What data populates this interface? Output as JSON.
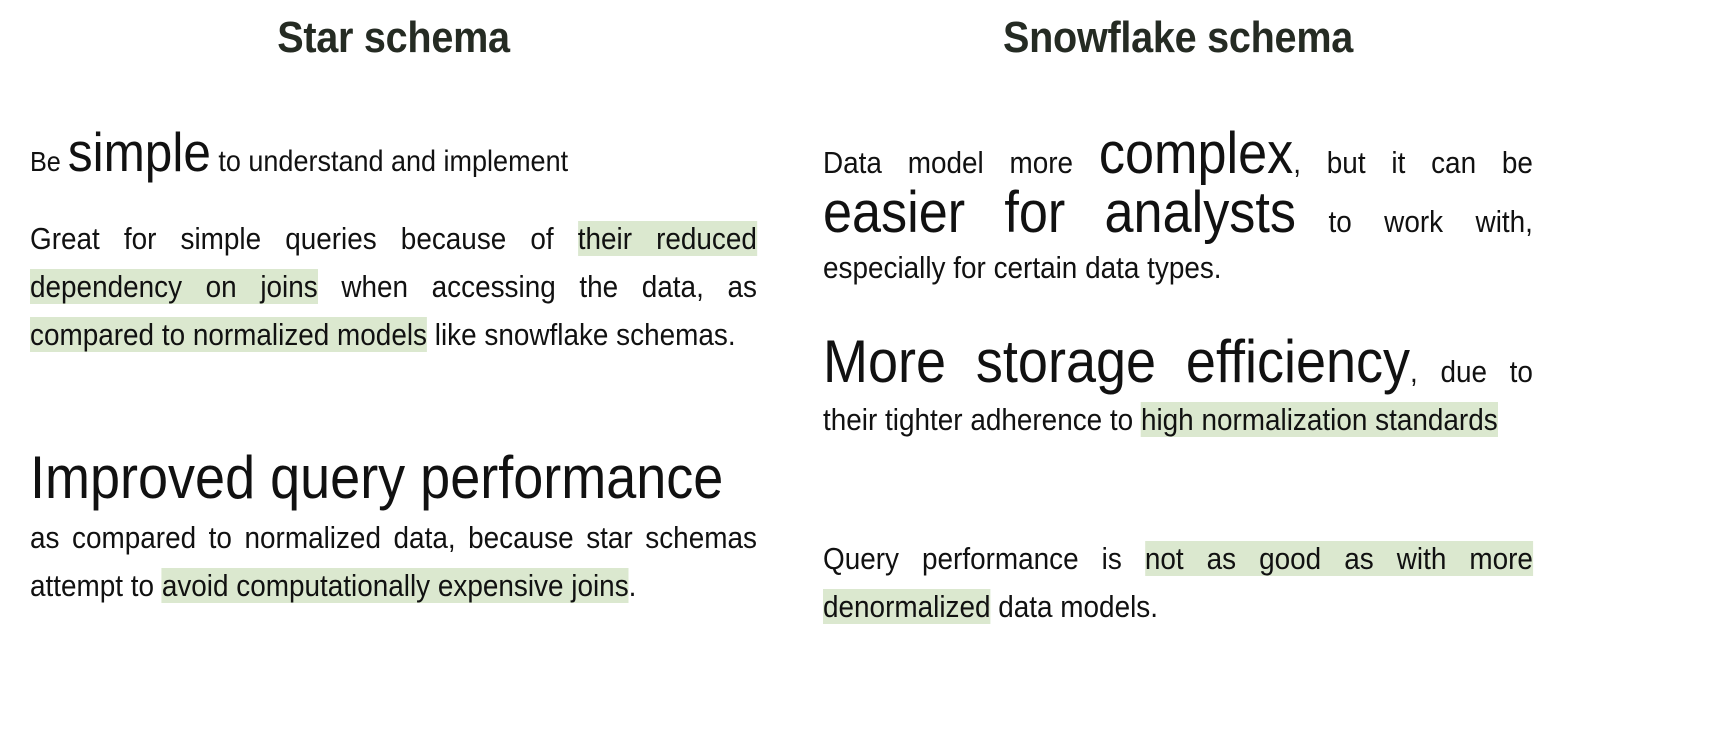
{
  "slide": {
    "background": "#ffffff",
    "highlight_color": "#dbe8cf",
    "title_color": "#252b23",
    "text_color": "#111111"
  },
  "columns": [
    {
      "id": "star-schema",
      "title": "Star schema",
      "paragraphs": [
        {
          "id": "star-p1",
          "runs": [
            {
              "text": "Be ",
              "size": "small",
              "highlight": false
            },
            {
              "text": "simple",
              "size": "xlarge",
              "highlight": false
            },
            {
              "text": " to understand and implement",
              "size": "medium",
              "highlight": false
            }
          ]
        },
        {
          "id": "star-p2",
          "runs": [
            {
              "text": "Great for simple queries because of ",
              "size": "medium",
              "highlight": false
            },
            {
              "text": "their reduced dependency on joins",
              "size": "medium",
              "highlight": true
            },
            {
              "text": " when accessing the data, as ",
              "size": "medium",
              "highlight": false
            },
            {
              "text": "compared to normalized models",
              "size": "medium",
              "highlight": true
            },
            {
              "text": " like snowflake schemas.",
              "size": "medium",
              "highlight": false
            }
          ]
        },
        {
          "id": "star-p3",
          "runs": [
            {
              "text": "Improved query performance",
              "size": "heading",
              "highlight": false
            },
            {
              "text": " as compared to normalized data, because star schemas attempt to ",
              "size": "medium",
              "highlight": false
            },
            {
              "text": "avoid computationally expensive joins",
              "size": "medium",
              "highlight": true
            },
            {
              "text": ".",
              "size": "medium",
              "highlight": false
            }
          ]
        }
      ]
    },
    {
      "id": "snowflake-schema",
      "title": "Snowflake schema",
      "paragraphs": [
        {
          "id": "snow-p1",
          "runs": [
            {
              "text": "Data model more ",
              "size": "medium",
              "highlight": false
            },
            {
              "text": "complex",
              "size": "xlarge",
              "highlight": false
            },
            {
              "text": ", but it can be ",
              "size": "medium",
              "highlight": false
            },
            {
              "text": "easier for analysts",
              "size": "xlarge",
              "highlight": false
            },
            {
              "text": " to work with, especially for certain data types.",
              "size": "medium",
              "highlight": false
            }
          ]
        },
        {
          "id": "snow-p2",
          "runs": [
            {
              "text": "More storage efficiency",
              "size": "heading",
              "highlight": false
            },
            {
              "text": ", due to their tighter adherence to ",
              "size": "medium",
              "highlight": false
            },
            {
              "text": "high normalization standards",
              "size": "medium",
              "highlight": true
            }
          ]
        },
        {
          "id": "snow-p3",
          "runs": [
            {
              "text": "Query performance is ",
              "size": "medium",
              "highlight": false
            },
            {
              "text": "not as good as with more denormalized",
              "size": "medium",
              "highlight": true
            },
            {
              "text": " data models.",
              "size": "medium",
              "highlight": false
            }
          ]
        }
      ]
    }
  ]
}
